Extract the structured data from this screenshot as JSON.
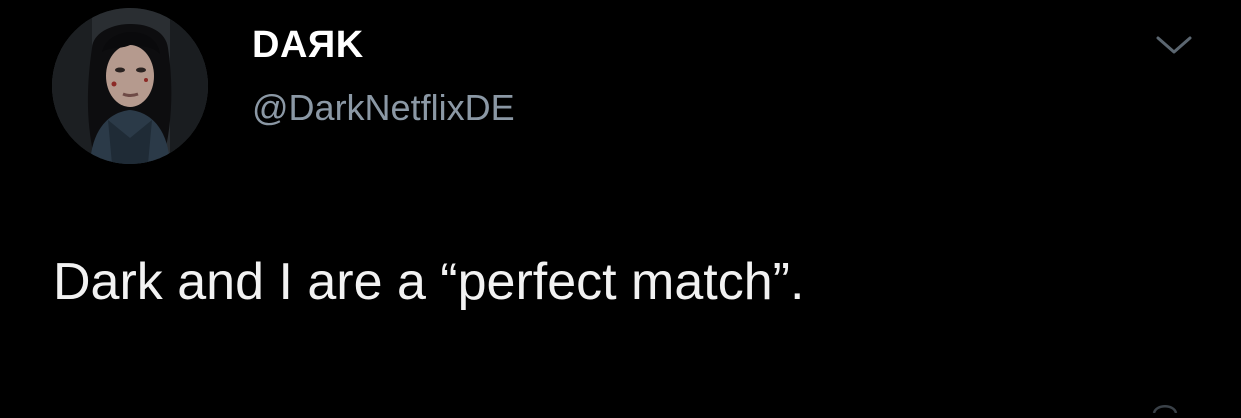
{
  "tweet": {
    "display_name": "DAЯK",
    "handle": "@DarkNetflixDE",
    "text": "Dark and I are a “perfect match”."
  },
  "icons": {
    "menu": "chevron-down-icon",
    "avatar": "profile-photo"
  },
  "colors": {
    "background": "#000000",
    "name": "#ffffff",
    "handle": "#8b98a5",
    "text": "#f2f2f2"
  }
}
